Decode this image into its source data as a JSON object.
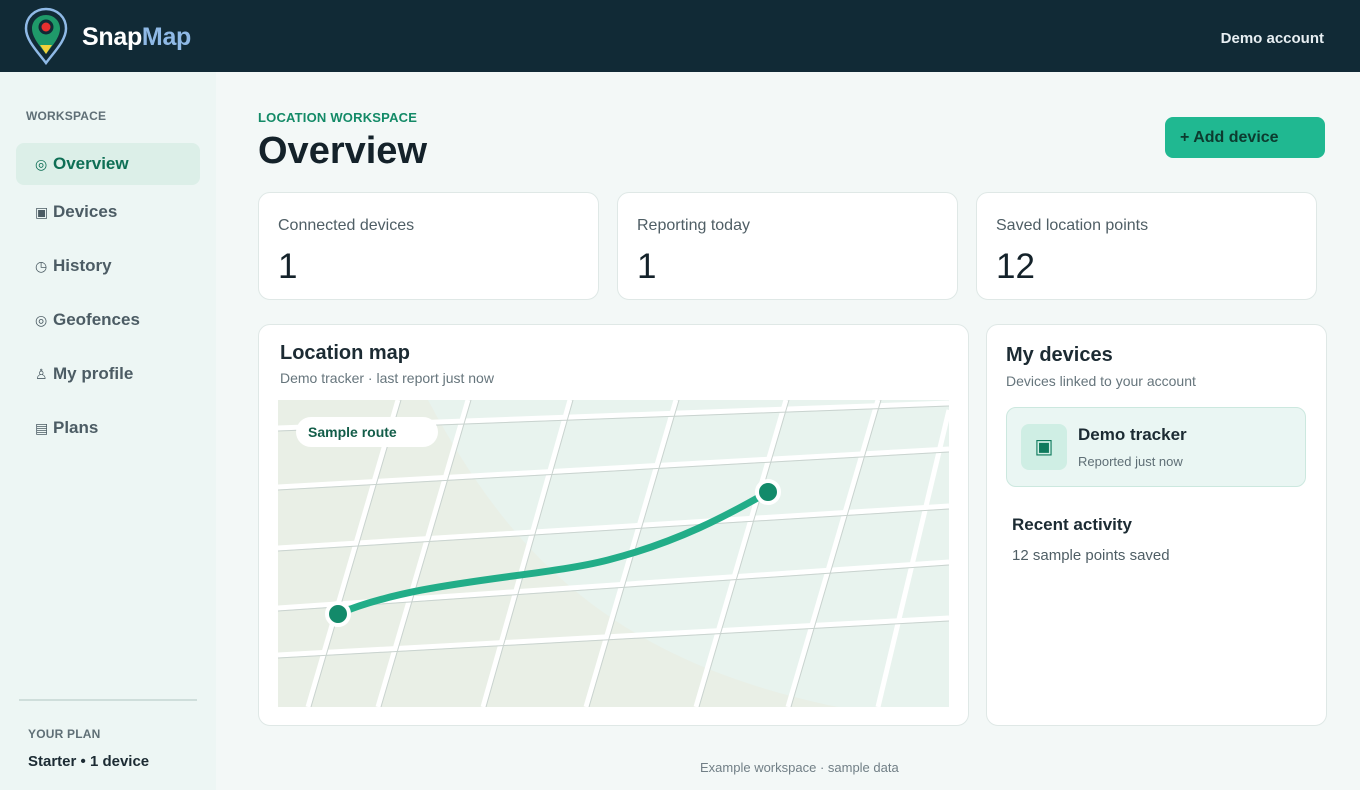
{
  "header": {
    "brand_primary": "Snap",
    "brand_secondary": "Map",
    "account_label": "Demo account"
  },
  "sidebar": {
    "section_heading": "WORKSPACE",
    "items": [
      {
        "icon": "◎",
        "icon_name": "target-icon",
        "label": "Overview",
        "active": true
      },
      {
        "icon": "▣",
        "icon_name": "device-icon",
        "label": "Devices"
      },
      {
        "icon": "◷",
        "icon_name": "clock-icon",
        "label": "History"
      },
      {
        "icon": "◎",
        "icon_name": "target-icon",
        "label": "Geofences"
      },
      {
        "icon": "♙",
        "icon_name": "person-icon",
        "label": "My profile"
      },
      {
        "icon": "▤",
        "icon_name": "list-icon",
        "label": "Plans"
      }
    ],
    "plan_heading": "YOUR PLAN",
    "plan_value": "Starter • 1 device"
  },
  "main": {
    "eyebrow": "LOCATION WORKSPACE",
    "title": "Overview",
    "add_button_label": "+ Add device",
    "stats": [
      {
        "label": "Connected devices",
        "value": "1"
      },
      {
        "label": "Reporting today",
        "value": "1"
      },
      {
        "label": "Saved location points",
        "value": "12"
      }
    ],
    "map_card": {
      "title": "Location map",
      "subtitle": "Demo tracker · last report just now",
      "route_chip": "Sample route"
    },
    "devices_card": {
      "title": "My devices",
      "subtitle": "Devices linked to your account",
      "device": {
        "icon": "▣",
        "name": "Demo tracker",
        "status": "Reported just now"
      },
      "activity_title": "Recent activity",
      "activity_text": "12 sample points saved"
    },
    "footer_note": "Example workspace · sample data"
  },
  "colors": {
    "topbar": "#112a36",
    "accent": "#20b891",
    "accent_dark": "#138a67",
    "route": "#22ad88",
    "marker": "#138a6a"
  }
}
